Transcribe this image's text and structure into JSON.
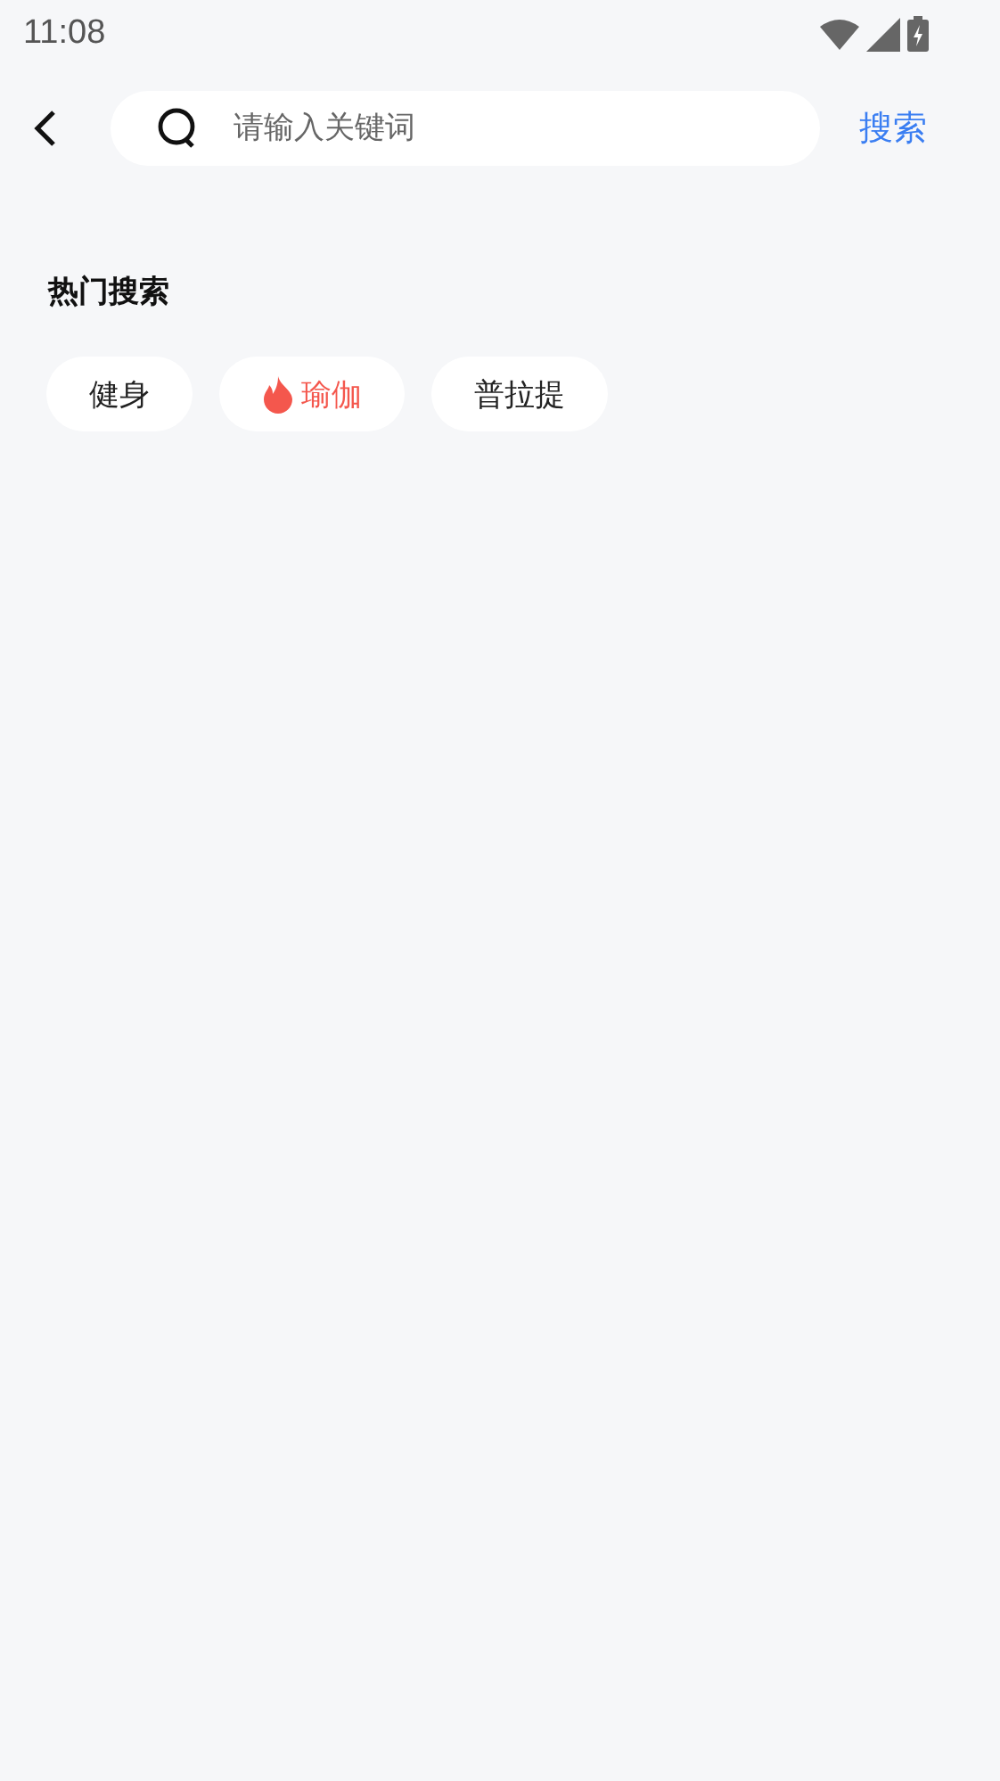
{
  "status_bar": {
    "time": "11:08"
  },
  "search": {
    "placeholder": "请输入关键词",
    "button": "搜索"
  },
  "hot_section": {
    "title": "热门搜索",
    "tags": [
      {
        "label": "健身",
        "hot": false
      },
      {
        "label": "瑜伽",
        "hot": true
      },
      {
        "label": "普拉提",
        "hot": false
      }
    ]
  }
}
